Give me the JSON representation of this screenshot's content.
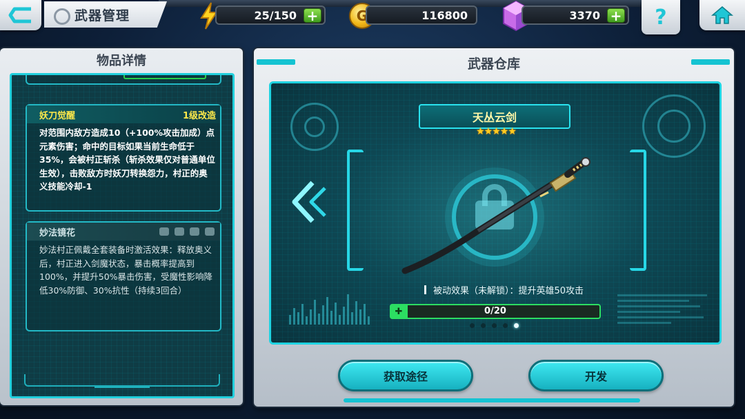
{
  "topbar": {
    "title": "武器管理",
    "energy": "25/150",
    "gold": "116800",
    "gems": "3370",
    "help_symbol": "?"
  },
  "left_panel": {
    "title": "物品详情",
    "skill1": {
      "name": "妖刀觉醒",
      "level": "1级改造",
      "description": "对范围内敌方造成10（+100%攻击加成）点元素伤害；命中的目标如果当前生命低于35%，会被村正斩杀（斩杀效果仅对普通单位生效），击败敌方时妖刀转换怨力，村正的奥义技能冷却-1"
    },
    "skill2": {
      "name": "妙法镜花",
      "description": "妙法村正佩戴全套装备时激活效果：释放奥义后，村正进入剑魔状态，暴击概率提高到100%，并提升50%暴击伤害，受魔性影响降低30%防御、30%抗性（持续3回合）"
    }
  },
  "right_panel": {
    "title": "武器仓库",
    "weapon_name": "天丛云剑",
    "stars": "★★★★★",
    "star_count": 5,
    "passive": "被动效果（未解锁）：提升英雄50攻击",
    "progress": {
      "current": 0,
      "max": 20,
      "label": "0/20"
    },
    "page_dots": 5,
    "active_dot": 4,
    "buttons": {
      "source": "获取途径",
      "develop": "开发"
    }
  },
  "colors": {
    "accent": "#1fd4e2",
    "gold_text": "#ffe94a",
    "progress_green": "#2cde62",
    "plus_green": "#5ac02e"
  }
}
